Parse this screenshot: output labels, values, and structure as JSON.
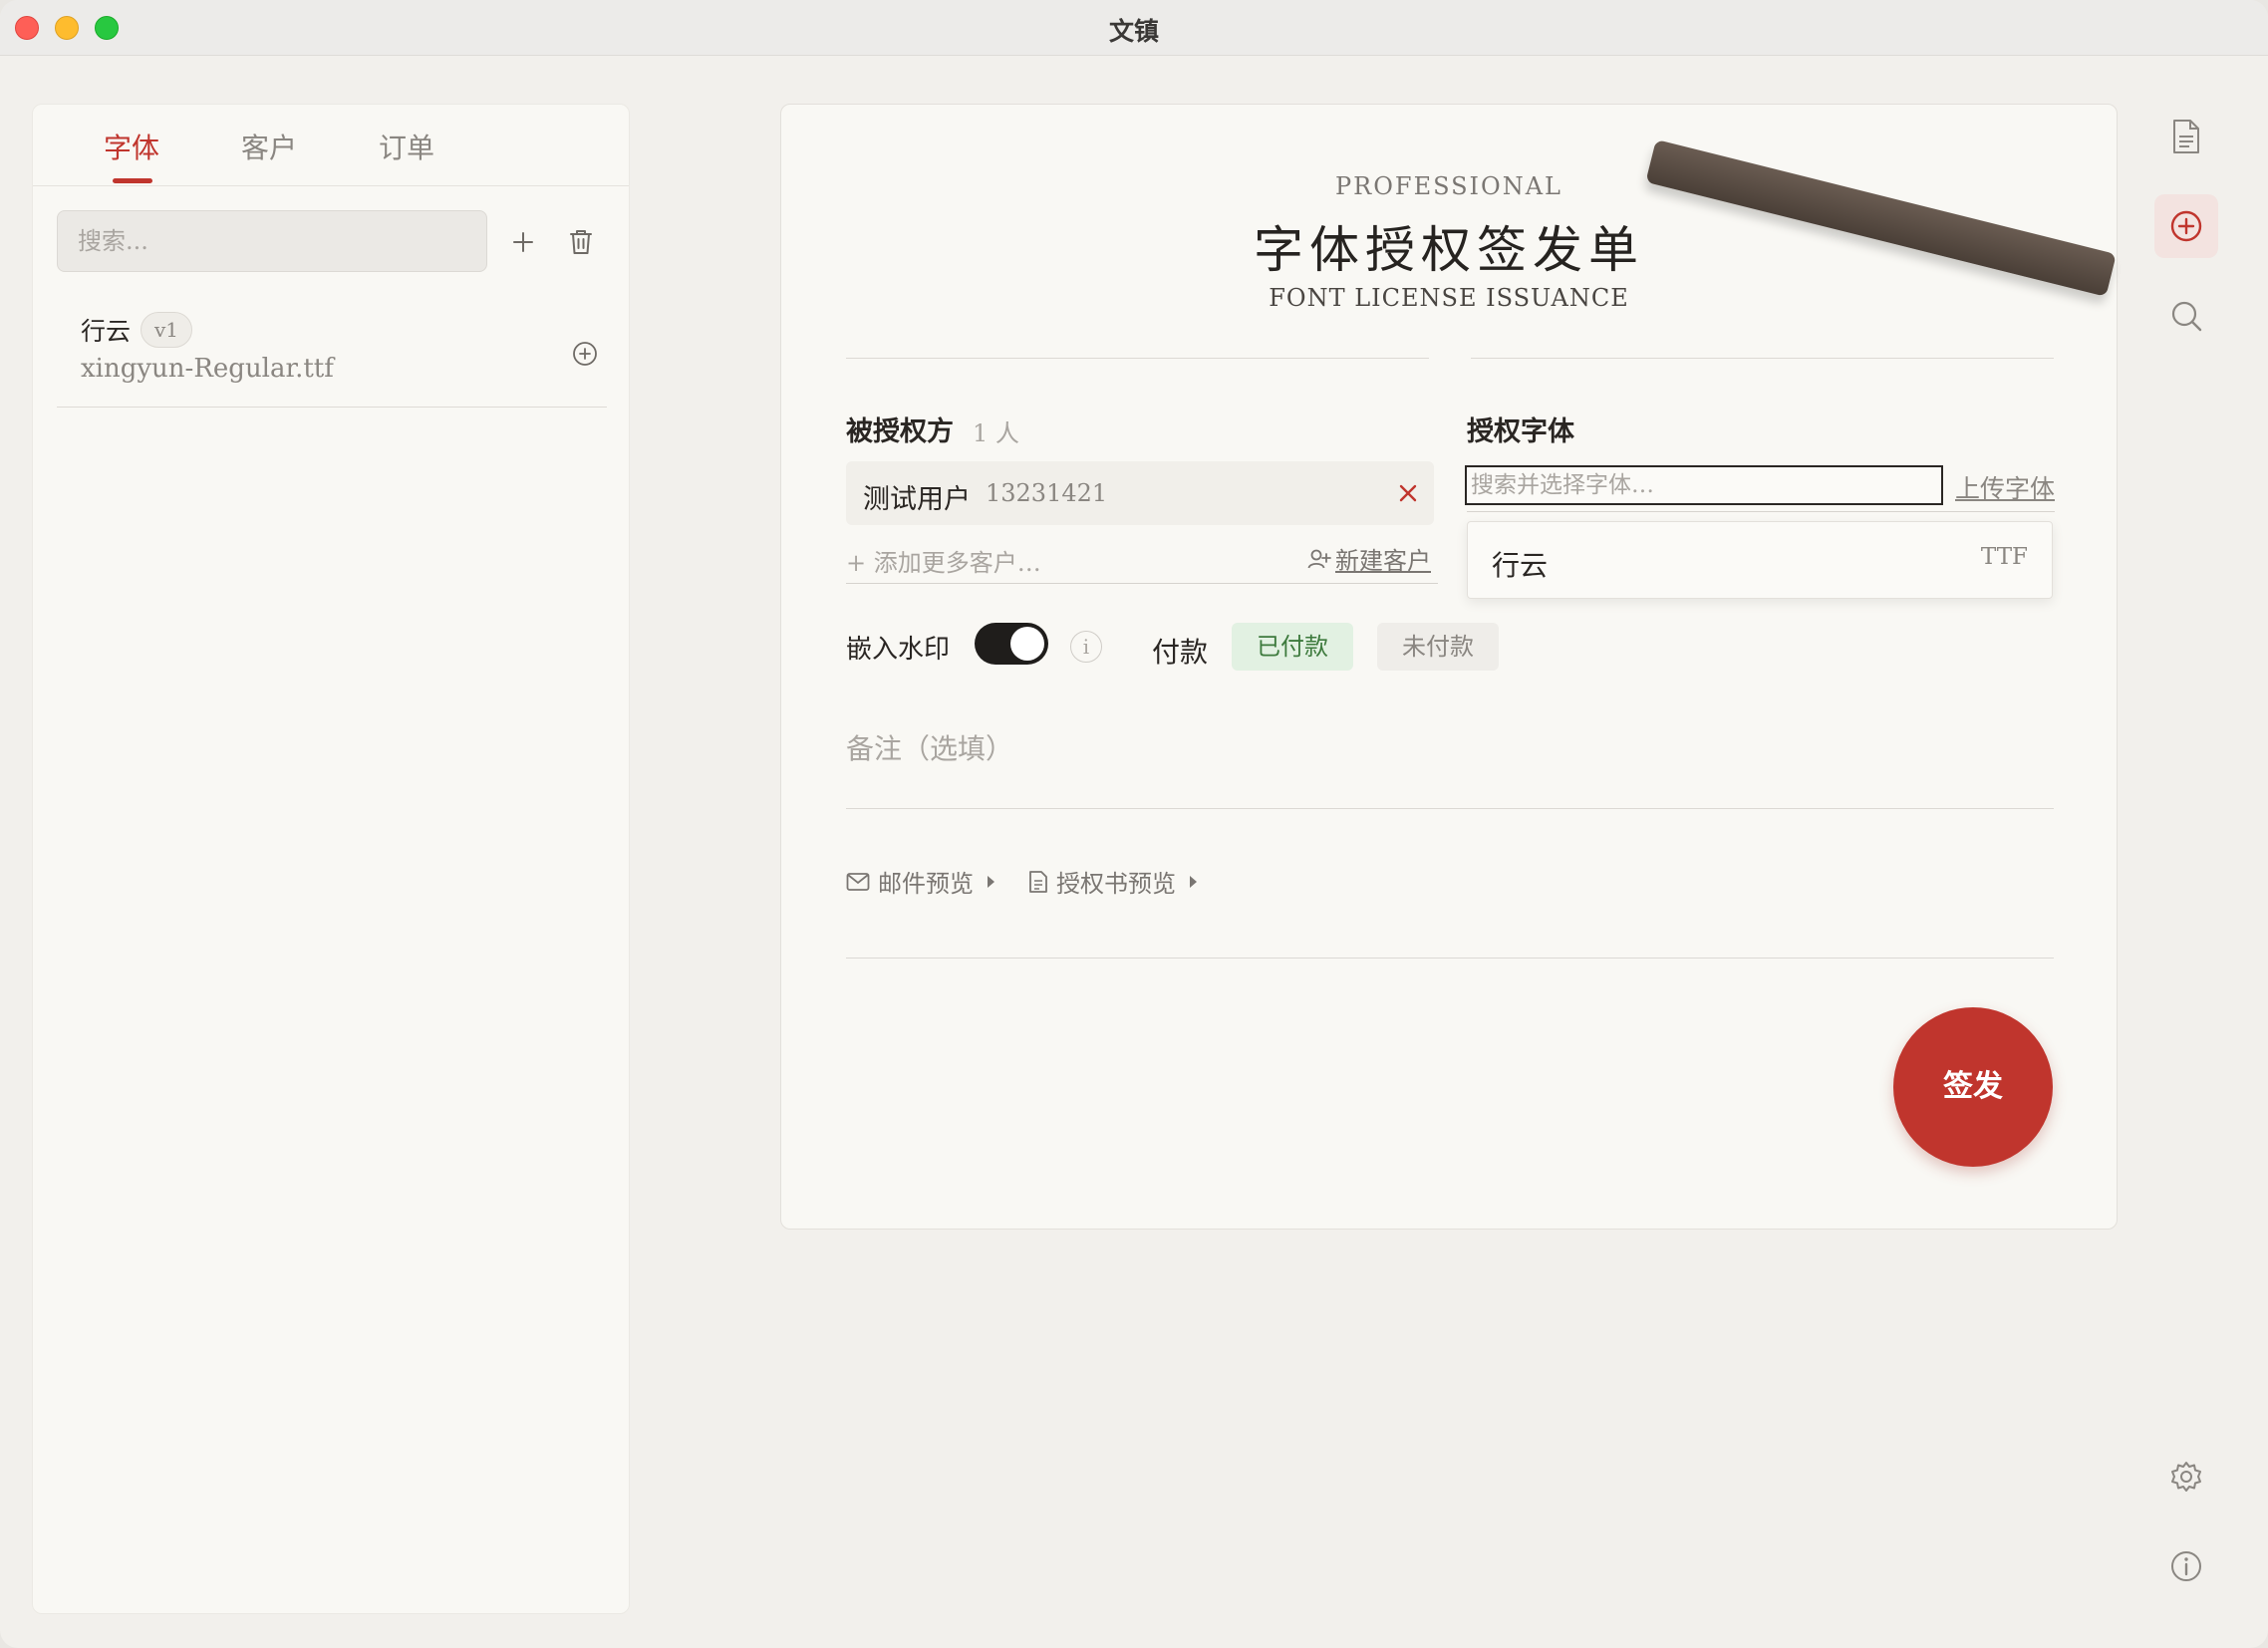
{
  "window": {
    "title": "文镇"
  },
  "sidebar": {
    "tabs": [
      {
        "label": "字体",
        "active": true
      },
      {
        "label": "客户",
        "active": false
      },
      {
        "label": "订单",
        "active": false
      }
    ],
    "search_placeholder": "搜索...",
    "fonts": [
      {
        "name": "行云",
        "version": "v1",
        "file": "xingyun-Regular.ttf"
      }
    ]
  },
  "card": {
    "eyebrow": "PROFESSIONAL",
    "title": "字体授权签发单",
    "subtitle": "FONT LICENSE ISSUANCE",
    "licensee": {
      "label": "被授权方",
      "count": "1 人",
      "chip_name": "测试用户",
      "chip_phone": "13231421",
      "add_more": "+ 添加更多客户…",
      "new_client": "新建客户"
    },
    "font_section": {
      "label": "授权字体",
      "search_placeholder": "搜索并选择字体…",
      "upload_label": "上传字体",
      "dropdown": {
        "name": "行云",
        "type": "TTF"
      }
    },
    "watermark": {
      "label": "嵌入水印",
      "enabled": true,
      "info": "i"
    },
    "payment": {
      "label": "付款",
      "paid": "已付款",
      "unpaid": "未付款",
      "selected": "已付款"
    },
    "notes_placeholder": "备注（选填）",
    "email_preview": "邮件预览",
    "license_preview": "授权书预览",
    "issue_button": "签发"
  },
  "colors": {
    "accent": "#c0352d",
    "paid_bg": "#e2f1e2",
    "paid_text": "#3d7a3d"
  }
}
